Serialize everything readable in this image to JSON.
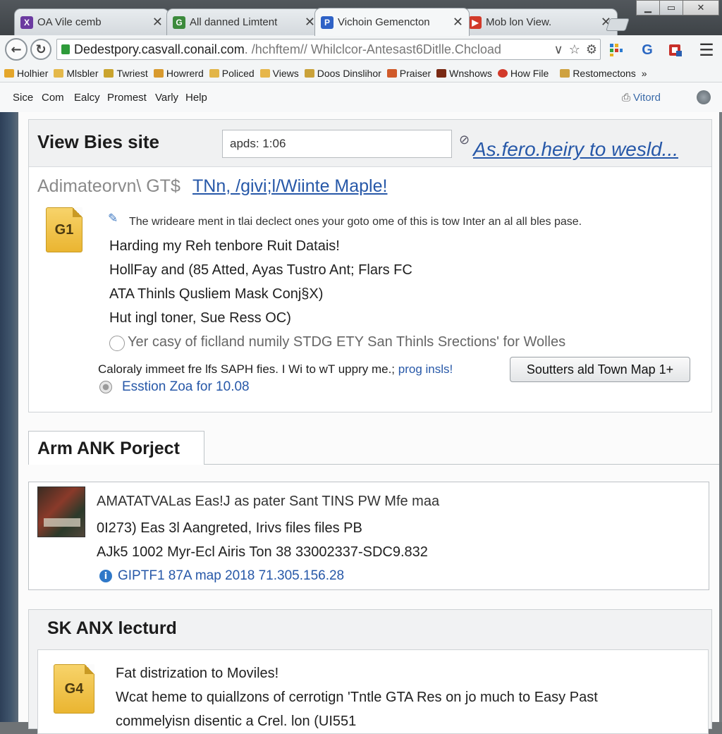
{
  "browser": {
    "tabs": [
      {
        "title": "OA Vile cemb",
        "favicon": "X",
        "color": "#6b3aa0"
      },
      {
        "title": "All danned Limtent",
        "favicon": "G",
        "color": "#3c8a3c"
      },
      {
        "title": "Vichoin Gemencton",
        "favicon": "P",
        "color": "#2f62c6"
      },
      {
        "title": "Mob lon View.",
        "favicon": "▶",
        "color": "#d23a2a"
      }
    ],
    "window_controls": {
      "minimize": "▁",
      "maximize": "▭",
      "close": "✕"
    },
    "nav": {
      "back": "←",
      "reload": "↻"
    },
    "url": {
      "host": "Dedestpory.casvall.conail.com",
      "path": ". /hchftem// Whilclcor-Antesast6Ditlle.Chcload"
    },
    "bookmarks": [
      {
        "label": "Holhier",
        "color": "#e4a62b"
      },
      {
        "label": "Mlsbler",
        "color": "#e4b84a"
      },
      {
        "label": "Twriest",
        "color": "#caa42e"
      },
      {
        "label": "Howrerd",
        "color": "#d89a2e"
      },
      {
        "label": "Policed",
        "color": "#e2b548"
      },
      {
        "label": "Views",
        "color": "#e6b64b"
      },
      {
        "label": "Doos Dinslihor",
        "color": "#caa23a"
      },
      {
        "label": "Praiser",
        "color": "#d05a2a"
      },
      {
        "label": "Wnshows",
        "color": "#7a2a14"
      },
      {
        "label": "How File",
        "color": "#d23a2a"
      },
      {
        "label": "Restomectons",
        "color": "#cfa240"
      }
    ],
    "bookmarks_more": "»"
  },
  "page_menu": {
    "items": [
      "Sice",
      "Com",
      "Ealcy",
      "Promest",
      "Varly",
      "Help"
    ],
    "right_label": "Vitord"
  },
  "view_panel": {
    "title": "View Bies site",
    "search_value": "apds: 1:06",
    "header_link": "As.fero.heiry to wesld...",
    "subtitle_gray": "Adimateorvn\\ GT$",
    "subtitle_link": "TNn, /givi;l/Wiinte Maple!",
    "file_icon": "G1",
    "description": "The wrideare ment in tlai declect ones your goto ome of this is tow Inter an al all bles pase.",
    "features": [
      "Harding my Reh tenbore Ruit Datais!",
      "HollFay and (85 Atted, Ayas Tustro Ant; Flars FC",
      "ATA Thinls Qusliem Mask Conj§X)",
      "Hut ingl toner, Sue Ress OC)"
    ],
    "checkbox_label": "Yer casy of ficlland numily STDG  ETY San Thinls Srections' for Wolles",
    "notice_text": "Caloraly immeet fre lfs SAPH fies. I Wi to wT uppry me.; ",
    "notice_link": "prog insls!",
    "download_button": "Soutters ald Town Map 1+",
    "version_link": "Esstion Zoa for 10.08"
  },
  "project_panel": {
    "tab_label": "Arm ANK Porject",
    "line1": "AMATATVALas Eas!J as pater Sant TINS PW Mfe maa",
    "line2": "0I273) Eas 3l Aangreted, Irivs files files PB",
    "line3": "AJk5 1002 Myr-Ecl Airis Ton 38  33002337-SDC9.832",
    "info_link": "GIPTF1 87A map 2018 71.305.156.28"
  },
  "lecture_panel": {
    "title": "SK ANX lecturd",
    "file_icon": "G4",
    "line1": "Fat distrization to Moviles!",
    "line2": "Wcat heme to quiallzons of cerrotign 'Tntle GTA Res on jo much to Easy Past",
    "line3": "commelyisn disentic a Crel. lon (UI551"
  }
}
